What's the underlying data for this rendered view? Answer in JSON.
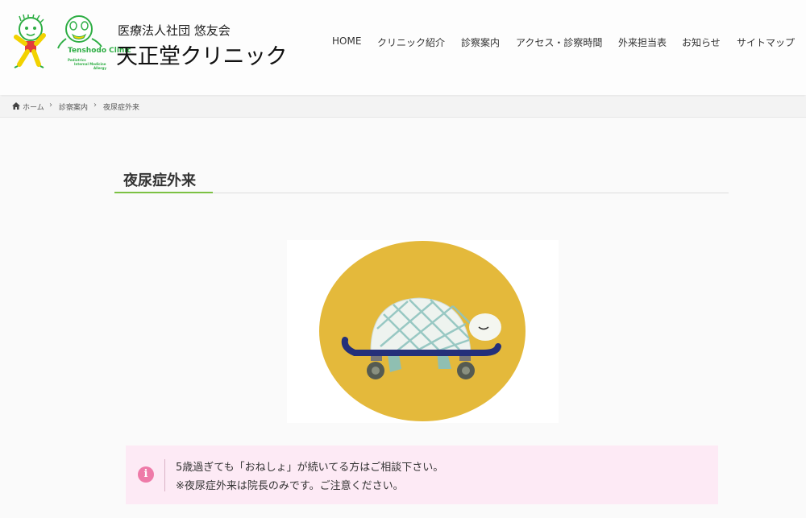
{
  "header": {
    "logo_text": "Tenshodo Clinic",
    "logo_sub1": "Pediatrics",
    "logo_sub2": "Internal Medicine",
    "logo_sub3": "Allergy",
    "site_subtitle": "医療法人社団 悠友会",
    "site_title": "天正堂クリニック"
  },
  "nav": {
    "items": [
      "HOME",
      "クリニック紹介",
      "診察案内",
      "アクセス・診察時間",
      "外来担当表",
      "お知らせ",
      "サイトマップ"
    ]
  },
  "breadcrumb": {
    "items": [
      "ホーム",
      "診察案内",
      "夜尿症外来"
    ]
  },
  "main": {
    "page_title": "夜尿症外来",
    "notice": {
      "icon": "i",
      "line1": "5歳過ぎても「おねしょ」が続いてる方はご相談下さい。",
      "line2": "※夜尿症外来は院長のみです。ご注意ください。"
    }
  },
  "colors": {
    "accent_green": "#7cc143",
    "notice_bg": "#fdeaf5",
    "notice_icon": "#ee7aa8",
    "illustration_circle": "#e4b93b",
    "skateboard": "#24307a"
  }
}
